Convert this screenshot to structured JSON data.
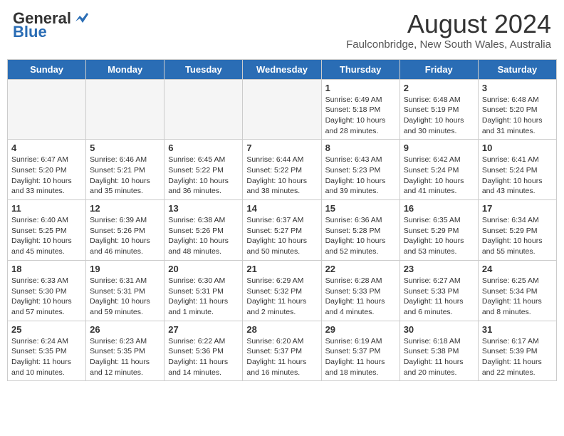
{
  "header": {
    "logo_general": "General",
    "logo_blue": "Blue",
    "month_year": "August 2024",
    "location": "Faulconbridge, New South Wales, Australia"
  },
  "days_of_week": [
    "Sunday",
    "Monday",
    "Tuesday",
    "Wednesday",
    "Thursday",
    "Friday",
    "Saturday"
  ],
  "weeks": [
    [
      {
        "day": "",
        "info": ""
      },
      {
        "day": "",
        "info": ""
      },
      {
        "day": "",
        "info": ""
      },
      {
        "day": "",
        "info": ""
      },
      {
        "day": "1",
        "info": "Sunrise: 6:49 AM\nSunset: 5:18 PM\nDaylight: 10 hours\nand 28 minutes."
      },
      {
        "day": "2",
        "info": "Sunrise: 6:48 AM\nSunset: 5:19 PM\nDaylight: 10 hours\nand 30 minutes."
      },
      {
        "day": "3",
        "info": "Sunrise: 6:48 AM\nSunset: 5:20 PM\nDaylight: 10 hours\nand 31 minutes."
      }
    ],
    [
      {
        "day": "4",
        "info": "Sunrise: 6:47 AM\nSunset: 5:20 PM\nDaylight: 10 hours\nand 33 minutes."
      },
      {
        "day": "5",
        "info": "Sunrise: 6:46 AM\nSunset: 5:21 PM\nDaylight: 10 hours\nand 35 minutes."
      },
      {
        "day": "6",
        "info": "Sunrise: 6:45 AM\nSunset: 5:22 PM\nDaylight: 10 hours\nand 36 minutes."
      },
      {
        "day": "7",
        "info": "Sunrise: 6:44 AM\nSunset: 5:22 PM\nDaylight: 10 hours\nand 38 minutes."
      },
      {
        "day": "8",
        "info": "Sunrise: 6:43 AM\nSunset: 5:23 PM\nDaylight: 10 hours\nand 39 minutes."
      },
      {
        "day": "9",
        "info": "Sunrise: 6:42 AM\nSunset: 5:24 PM\nDaylight: 10 hours\nand 41 minutes."
      },
      {
        "day": "10",
        "info": "Sunrise: 6:41 AM\nSunset: 5:24 PM\nDaylight: 10 hours\nand 43 minutes."
      }
    ],
    [
      {
        "day": "11",
        "info": "Sunrise: 6:40 AM\nSunset: 5:25 PM\nDaylight: 10 hours\nand 45 minutes."
      },
      {
        "day": "12",
        "info": "Sunrise: 6:39 AM\nSunset: 5:26 PM\nDaylight: 10 hours\nand 46 minutes."
      },
      {
        "day": "13",
        "info": "Sunrise: 6:38 AM\nSunset: 5:26 PM\nDaylight: 10 hours\nand 48 minutes."
      },
      {
        "day": "14",
        "info": "Sunrise: 6:37 AM\nSunset: 5:27 PM\nDaylight: 10 hours\nand 50 minutes."
      },
      {
        "day": "15",
        "info": "Sunrise: 6:36 AM\nSunset: 5:28 PM\nDaylight: 10 hours\nand 52 minutes."
      },
      {
        "day": "16",
        "info": "Sunrise: 6:35 AM\nSunset: 5:29 PM\nDaylight: 10 hours\nand 53 minutes."
      },
      {
        "day": "17",
        "info": "Sunrise: 6:34 AM\nSunset: 5:29 PM\nDaylight: 10 hours\nand 55 minutes."
      }
    ],
    [
      {
        "day": "18",
        "info": "Sunrise: 6:33 AM\nSunset: 5:30 PM\nDaylight: 10 hours\nand 57 minutes."
      },
      {
        "day": "19",
        "info": "Sunrise: 6:31 AM\nSunset: 5:31 PM\nDaylight: 10 hours\nand 59 minutes."
      },
      {
        "day": "20",
        "info": "Sunrise: 6:30 AM\nSunset: 5:31 PM\nDaylight: 11 hours\nand 1 minute."
      },
      {
        "day": "21",
        "info": "Sunrise: 6:29 AM\nSunset: 5:32 PM\nDaylight: 11 hours\nand 2 minutes."
      },
      {
        "day": "22",
        "info": "Sunrise: 6:28 AM\nSunset: 5:33 PM\nDaylight: 11 hours\nand 4 minutes."
      },
      {
        "day": "23",
        "info": "Sunrise: 6:27 AM\nSunset: 5:33 PM\nDaylight: 11 hours\nand 6 minutes."
      },
      {
        "day": "24",
        "info": "Sunrise: 6:25 AM\nSunset: 5:34 PM\nDaylight: 11 hours\nand 8 minutes."
      }
    ],
    [
      {
        "day": "25",
        "info": "Sunrise: 6:24 AM\nSunset: 5:35 PM\nDaylight: 11 hours\nand 10 minutes."
      },
      {
        "day": "26",
        "info": "Sunrise: 6:23 AM\nSunset: 5:35 PM\nDaylight: 11 hours\nand 12 minutes."
      },
      {
        "day": "27",
        "info": "Sunrise: 6:22 AM\nSunset: 5:36 PM\nDaylight: 11 hours\nand 14 minutes."
      },
      {
        "day": "28",
        "info": "Sunrise: 6:20 AM\nSunset: 5:37 PM\nDaylight: 11 hours\nand 16 minutes."
      },
      {
        "day": "29",
        "info": "Sunrise: 6:19 AM\nSunset: 5:37 PM\nDaylight: 11 hours\nand 18 minutes."
      },
      {
        "day": "30",
        "info": "Sunrise: 6:18 AM\nSunset: 5:38 PM\nDaylight: 11 hours\nand 20 minutes."
      },
      {
        "day": "31",
        "info": "Sunrise: 6:17 AM\nSunset: 5:39 PM\nDaylight: 11 hours\nand 22 minutes."
      }
    ]
  ]
}
